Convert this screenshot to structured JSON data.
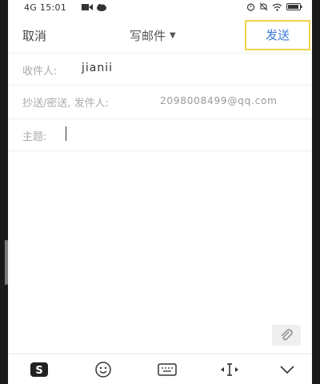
{
  "status_bar": {
    "network": "4G",
    "time": "15:01"
  },
  "header": {
    "cancel_label": "取消",
    "title": "写邮件",
    "send_label": "发送",
    "highlight_color": "#f2d34a",
    "send_color": "#3b78d9"
  },
  "compose": {
    "to_label": "收件人:",
    "to_value": "jianii",
    "cc_label": "抄送/密送, 发件人:",
    "cc_value": "2098008499@qq.com",
    "subject_label": "主题:",
    "subject_value": ""
  },
  "icons": {
    "attach": "paperclip-icon",
    "keyboard_logo": "sogou-s-icon",
    "emoji": "smiley-icon",
    "keyboard": "keyboard-icon",
    "cursor_move": "text-cursor-arrows-icon",
    "collapse": "chevron-down-icon"
  }
}
